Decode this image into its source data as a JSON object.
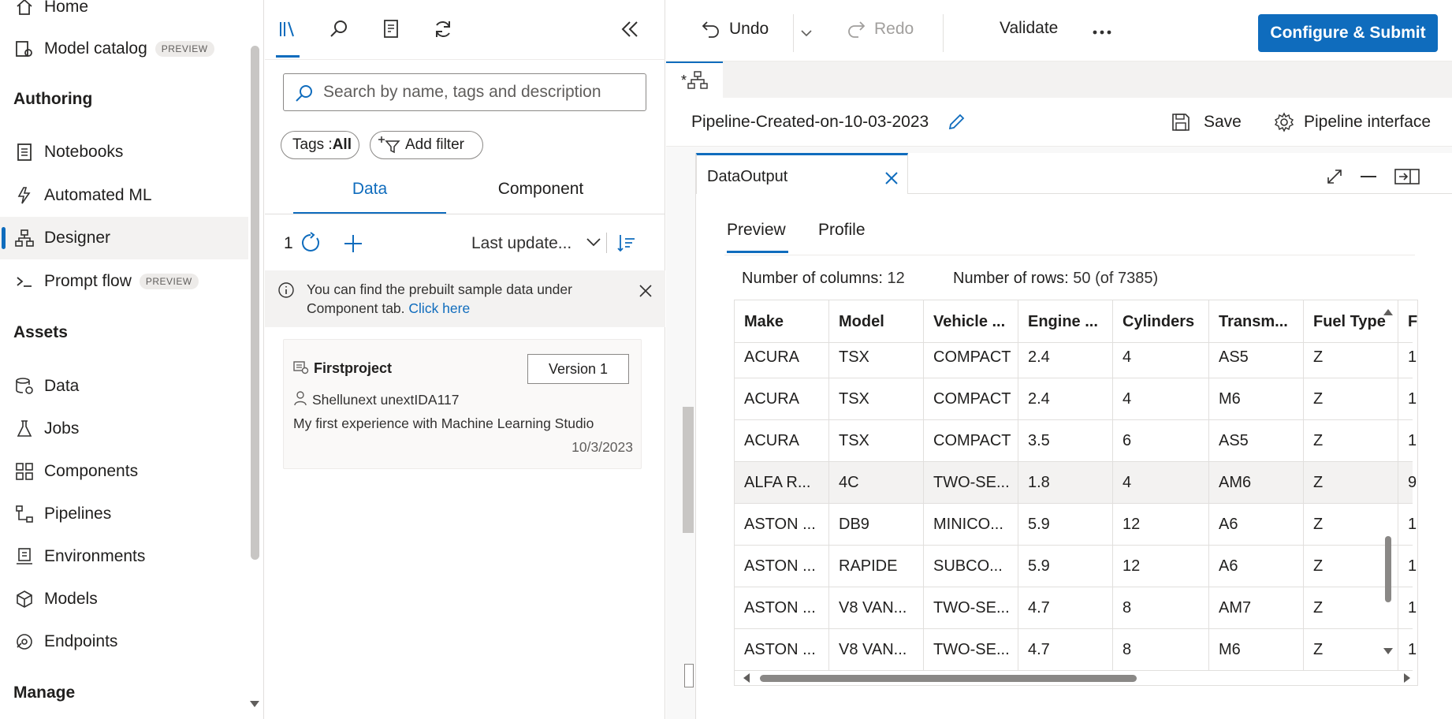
{
  "nav": {
    "items": [
      {
        "label": "Home",
        "icon": "home-icon"
      },
      {
        "label": "Model catalog",
        "badge": "PREVIEW",
        "icon": "model-catalog-icon"
      },
      {
        "label": "Notebooks",
        "icon": "notebook-icon"
      },
      {
        "label": "Automated ML",
        "icon": "automl-icon"
      },
      {
        "label": "Designer",
        "icon": "designer-icon"
      },
      {
        "label": "Prompt flow",
        "badge": "PREVIEW",
        "icon": "prompt-flow-icon"
      },
      {
        "label": "Data",
        "icon": "data-icon"
      },
      {
        "label": "Jobs",
        "icon": "jobs-icon"
      },
      {
        "label": "Components",
        "icon": "components-icon"
      },
      {
        "label": "Pipelines",
        "icon": "pipelines-icon"
      },
      {
        "label": "Environments",
        "icon": "environments-icon"
      },
      {
        "label": "Models",
        "icon": "models-icon"
      },
      {
        "label": "Endpoints",
        "icon": "endpoints-icon"
      }
    ],
    "headings": {
      "authoring": "Authoring",
      "assets": "Assets",
      "manage": "Manage"
    },
    "active": "Designer"
  },
  "panel": {
    "search_placeholder": "Search by name, tags and description",
    "tags_label": "Tags : ",
    "tags_value": "All",
    "add_filter": "Add filter",
    "tabs": [
      "Data",
      "Component"
    ],
    "active_tab": "Data",
    "count": "1",
    "sort_label": "Last update...",
    "info_line1": "You can find the prebuilt sample data under",
    "info_line2": "Component tab.",
    "info_link": "Click here",
    "card": {
      "title": "Firstproject",
      "version": "Version 1",
      "owner": "Shellunext unextIDA117",
      "description": "My first experience with Machine Learning Studio",
      "date": "10/3/2023"
    }
  },
  "toolbar": {
    "undo": "Undo",
    "redo": "Redo",
    "validate": "Validate",
    "submit": "Configure & Submit"
  },
  "pipeline": {
    "tab_label": "*",
    "title": "Pipeline-Created-on-10-03-2023",
    "save": "Save",
    "interface": "Pipeline interface"
  },
  "data_output": {
    "tab_title": "DataOutput",
    "subtabs": [
      "Preview",
      "Profile"
    ],
    "active_subtab": "Preview",
    "columns_label": "Number of columns:",
    "columns_value": "12",
    "rows_label": "Number of rows:",
    "rows_value": "50 (of 7385)",
    "headers": [
      "Make",
      "Model",
      "Vehicle ...",
      "Engine ...",
      "Cylinders",
      "Transm...",
      "Fuel Type",
      "F"
    ],
    "rows": [
      [
        "ACURA",
        "TSX",
        "COMPACT",
        "2.4",
        "4",
        "AS5",
        "Z",
        "1"
      ],
      [
        "ACURA",
        "TSX",
        "COMPACT",
        "2.4",
        "4",
        "M6",
        "Z",
        "1"
      ],
      [
        "ACURA",
        "TSX",
        "COMPACT",
        "3.5",
        "6",
        "AS5",
        "Z",
        "1"
      ],
      [
        "ALFA R...",
        "4C",
        "TWO-SE...",
        "1.8",
        "4",
        "AM6",
        "Z",
        "9"
      ],
      [
        "ASTON ...",
        "DB9",
        "MINICO...",
        "5.9",
        "12",
        "A6",
        "Z",
        "1"
      ],
      [
        "ASTON ...",
        "RAPIDE",
        "SUBCO...",
        "5.9",
        "12",
        "A6",
        "Z",
        "1"
      ],
      [
        "ASTON ...",
        "V8 VAN...",
        "TWO-SE...",
        "4.7",
        "8",
        "AM7",
        "Z",
        "1"
      ],
      [
        "ASTON ...",
        "V8 VAN...",
        "TWO-SE...",
        "4.7",
        "8",
        "M6",
        "Z",
        "1"
      ]
    ]
  },
  "colors": {
    "accent": "#0f6cbd",
    "text": "#201f1e",
    "subtle": "#605e5c"
  }
}
